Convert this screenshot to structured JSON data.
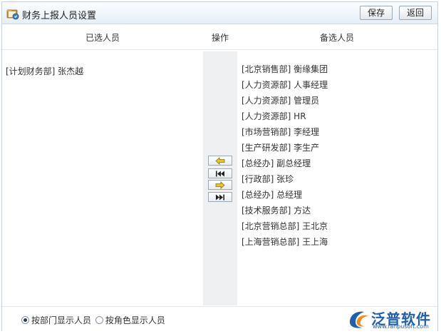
{
  "window": {
    "title": "财务上报人员设置",
    "save_label": "保存",
    "back_label": "返回"
  },
  "columns": {
    "selected_header": "已选人员",
    "ops_header": "操作",
    "candidates_header": "备选人员"
  },
  "selected": [
    {
      "label": "[计划财务部] 张杰越"
    }
  ],
  "candidates": [
    {
      "label": "[北京销售部] 衡缘集团"
    },
    {
      "label": "[人力资源部] 人事经理"
    },
    {
      "label": "[人力资源部] 管理员"
    },
    {
      "label": "[人力资源部] HR"
    },
    {
      "label": "[市场营销部] 李经理"
    },
    {
      "label": "[生产研发部] 李生产"
    },
    {
      "label": "[总经办] 副总经理"
    },
    {
      "label": "[行政部] 张珍"
    },
    {
      "label": "[总经办] 总经理"
    },
    {
      "label": "[技术服务部] 方达"
    },
    {
      "label": "[北京营销总部] 王北京"
    },
    {
      "label": "[上海营销总部] 王上海"
    }
  ],
  "ops": {
    "icons": [
      "arrow-left-icon",
      "double-arrow-left-icon",
      "arrow-right-icon",
      "double-arrow-right-icon"
    ]
  },
  "footer": {
    "radio_dept_label": "按部门显示人员",
    "radio_role_label": "按角色显示人员",
    "selected_option": "dept"
  },
  "logo": {
    "text": "泛普软件",
    "url": "www.fanpusoft.com"
  },
  "colors": {
    "arrow_fill": "#e8c81a",
    "arrow_stroke": "#8a6d00",
    "logo_blue": "#1f5fae",
    "logo_orange": "#f08a1c"
  }
}
